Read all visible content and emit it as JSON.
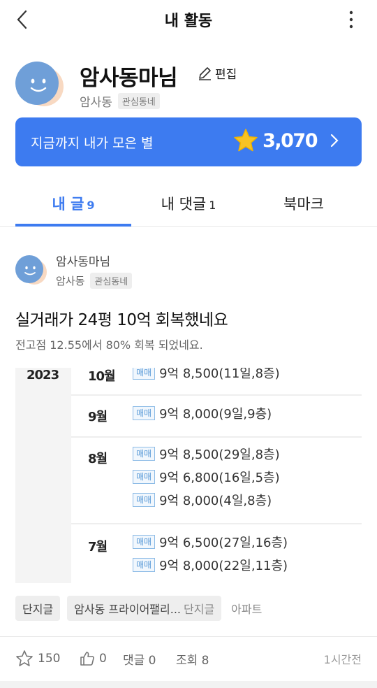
{
  "header": {
    "title": "내 활동"
  },
  "profile": {
    "name": "암사동마님",
    "edit_label": "편집",
    "location": "암사동",
    "location_tag": "관심동네"
  },
  "stars_banner": {
    "label": "지금까지 내가 모은 별",
    "count": "3,070"
  },
  "tabs": [
    {
      "label": "내 글",
      "count": "9"
    },
    {
      "label": "내 댓글",
      "count": "1"
    },
    {
      "label": "북마크"
    }
  ],
  "post": {
    "author": "암사동마님",
    "location": "암사동",
    "location_tag": "관심동네",
    "title": "실거래가 24평 10억 회복했네요",
    "body": "전고점 12.55에서 80% 회복 되었네요.",
    "image": {
      "year": "2023",
      "months": [
        {
          "month": "10월",
          "trades": [
            {
              "type": "매매",
              "text": "9억 8,500(11일,8층)"
            }
          ]
        },
        {
          "month": "9월",
          "trades": [
            {
              "type": "매매",
              "text": "9억 8,000(9일,9층)"
            }
          ]
        },
        {
          "month": "8월",
          "trades": [
            {
              "type": "매매",
              "text": "9억 8,500(29일,8층)"
            },
            {
              "type": "매매",
              "text": "9억 6,800(16일,5층)"
            },
            {
              "type": "매매",
              "text": "9억 8,000(4일,8층)"
            }
          ]
        },
        {
          "month": "7월",
          "trades": [
            {
              "type": "매매",
              "text": "9억 6,500(27일,16층)"
            },
            {
              "type": "매매",
              "text": "9억 8,000(22일,11층)"
            }
          ]
        }
      ]
    },
    "tags": {
      "tag1": "단지글",
      "tag2_main": "암사동 프라이어팰리...",
      "tag2_sub": "단지글",
      "tag3": "아파트"
    },
    "footer": {
      "likes": "150",
      "thumbs": "0",
      "comments": "댓글 0",
      "views": "조회 8",
      "time": "1시간전"
    }
  },
  "colors": {
    "accent": "#3d7bf0",
    "star": "#f7c325",
    "avatar": "#6f9fd8"
  }
}
